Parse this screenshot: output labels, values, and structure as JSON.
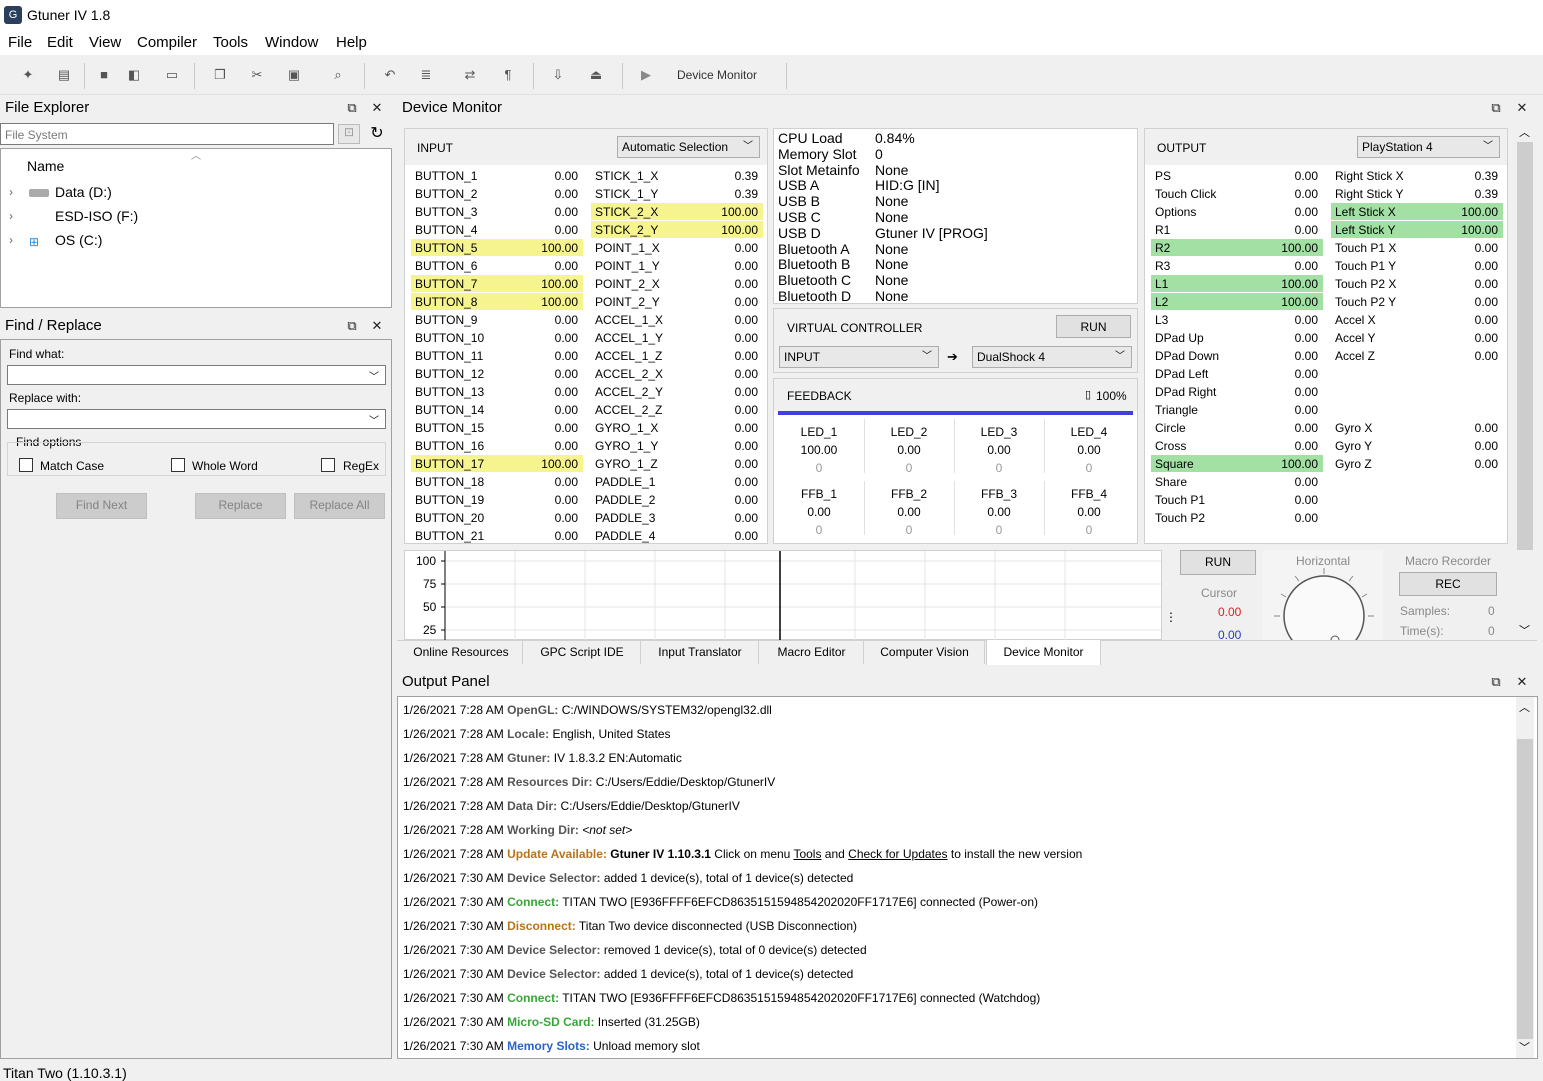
{
  "window": {
    "title": "Gtuner IV 1.8"
  },
  "menu": [
    "File",
    "Edit",
    "View",
    "Compiler",
    "Tools",
    "Window",
    "Help"
  ],
  "toolbar": {
    "device_monitor_label": "Device Monitor"
  },
  "file_explorer": {
    "title": "File Explorer",
    "filter_placeholder": "File System",
    "column_header": "Name",
    "items": [
      "Data (D:)",
      "ESD-ISO (F:)",
      "OS (C:)"
    ]
  },
  "find_replace": {
    "title": "Find / Replace",
    "find_label": "Find what:",
    "replace_label": "Replace with:",
    "options_label": "Find options",
    "match_case": "Match Case",
    "whole_word": "Whole Word",
    "regex": "RegEx",
    "find_next": "Find Next",
    "replace": "Replace",
    "replace_all": "Replace All"
  },
  "device_monitor": {
    "title": "Device Monitor",
    "input": {
      "header": "INPUT",
      "selection": "Automatic Selection",
      "col1": [
        {
          "name": "BUTTON_1",
          "value": "0.00",
          "hl": false
        },
        {
          "name": "BUTTON_2",
          "value": "0.00",
          "hl": false
        },
        {
          "name": "BUTTON_3",
          "value": "0.00",
          "hl": false
        },
        {
          "name": "BUTTON_4",
          "value": "0.00",
          "hl": false
        },
        {
          "name": "BUTTON_5",
          "value": "100.00",
          "hl": true
        },
        {
          "name": "BUTTON_6",
          "value": "0.00",
          "hl": false
        },
        {
          "name": "BUTTON_7",
          "value": "100.00",
          "hl": true
        },
        {
          "name": "BUTTON_8",
          "value": "100.00",
          "hl": true
        },
        {
          "name": "BUTTON_9",
          "value": "0.00",
          "hl": false
        },
        {
          "name": "BUTTON_10",
          "value": "0.00",
          "hl": false
        },
        {
          "name": "BUTTON_11",
          "value": "0.00",
          "hl": false
        },
        {
          "name": "BUTTON_12",
          "value": "0.00",
          "hl": false
        },
        {
          "name": "BUTTON_13",
          "value": "0.00",
          "hl": false
        },
        {
          "name": "BUTTON_14",
          "value": "0.00",
          "hl": false
        },
        {
          "name": "BUTTON_15",
          "value": "0.00",
          "hl": false
        },
        {
          "name": "BUTTON_16",
          "value": "0.00",
          "hl": false
        },
        {
          "name": "BUTTON_17",
          "value": "100.00",
          "hl": true
        },
        {
          "name": "BUTTON_18",
          "value": "0.00",
          "hl": false
        },
        {
          "name": "BUTTON_19",
          "value": "0.00",
          "hl": false
        },
        {
          "name": "BUTTON_20",
          "value": "0.00",
          "hl": false
        },
        {
          "name": "BUTTON_21",
          "value": "0.00",
          "hl": false
        }
      ],
      "col2": [
        {
          "name": "STICK_1_X",
          "value": "0.39",
          "hl": false
        },
        {
          "name": "STICK_1_Y",
          "value": "0.39",
          "hl": false
        },
        {
          "name": "STICK_2_X",
          "value": "100.00",
          "hl": true
        },
        {
          "name": "STICK_2_Y",
          "value": "100.00",
          "hl": true
        },
        {
          "name": "POINT_1_X",
          "value": "0.00",
          "hl": false
        },
        {
          "name": "POINT_1_Y",
          "value": "0.00",
          "hl": false
        },
        {
          "name": "POINT_2_X",
          "value": "0.00",
          "hl": false
        },
        {
          "name": "POINT_2_Y",
          "value": "0.00",
          "hl": false
        },
        {
          "name": "ACCEL_1_X",
          "value": "0.00",
          "hl": false
        },
        {
          "name": "ACCEL_1_Y",
          "value": "0.00",
          "hl": false
        },
        {
          "name": "ACCEL_1_Z",
          "value": "0.00",
          "hl": false
        },
        {
          "name": "ACCEL_2_X",
          "value": "0.00",
          "hl": false
        },
        {
          "name": "ACCEL_2_Y",
          "value": "0.00",
          "hl": false
        },
        {
          "name": "ACCEL_2_Z",
          "value": "0.00",
          "hl": false
        },
        {
          "name": "GYRO_1_X",
          "value": "0.00",
          "hl": false
        },
        {
          "name": "GYRO_1_Y",
          "value": "0.00",
          "hl": false
        },
        {
          "name": "GYRO_1_Z",
          "value": "0.00",
          "hl": false
        },
        {
          "name": "PADDLE_1",
          "value": "0.00",
          "hl": false
        },
        {
          "name": "PADDLE_2",
          "value": "0.00",
          "hl": false
        },
        {
          "name": "PADDLE_3",
          "value": "0.00",
          "hl": false
        },
        {
          "name": "PADDLE_4",
          "value": "0.00",
          "hl": false
        }
      ]
    },
    "info": [
      {
        "label": "CPU Load",
        "value": "0.84%"
      },
      {
        "label": "Memory Slot",
        "value": "0"
      },
      {
        "label": "Slot Metainfo",
        "value": "None"
      },
      {
        "label": "USB A",
        "value": "HID:G [IN]"
      },
      {
        "label": "USB B",
        "value": "None"
      },
      {
        "label": "USB C",
        "value": "None"
      },
      {
        "label": "USB D",
        "value": "Gtuner IV [PROG]"
      },
      {
        "label": "Bluetooth A",
        "value": "None"
      },
      {
        "label": "Bluetooth B",
        "value": "None"
      },
      {
        "label": "Bluetooth C",
        "value": "None"
      },
      {
        "label": "Bluetooth D",
        "value": "None"
      }
    ],
    "virtual_controller": {
      "header": "VIRTUAL CONTROLLER",
      "run": "RUN",
      "source": "INPUT",
      "target": "DualShock 4",
      "arrow": "➔"
    },
    "feedback": {
      "header": "FEEDBACK",
      "battery": "100%",
      "leds": [
        {
          "name": "LED_1",
          "value": "100.00",
          "sub": "0"
        },
        {
          "name": "LED_2",
          "value": "0.00",
          "sub": "0"
        },
        {
          "name": "LED_3",
          "value": "0.00",
          "sub": "0"
        },
        {
          "name": "LED_4",
          "value": "0.00",
          "sub": "0"
        }
      ],
      "ffb": [
        {
          "name": "FFB_1",
          "value": "0.00",
          "sub": "0"
        },
        {
          "name": "FFB_2",
          "value": "0.00",
          "sub": "0"
        },
        {
          "name": "FFB_3",
          "value": "0.00",
          "sub": "0"
        },
        {
          "name": "FFB_4",
          "value": "0.00",
          "sub": "0"
        }
      ]
    },
    "output": {
      "header": "OUTPUT",
      "selection": "PlayStation 4",
      "col1": [
        {
          "name": "PS",
          "value": "0.00",
          "hl": false
        },
        {
          "name": "Touch Click",
          "value": "0.00",
          "hl": false
        },
        {
          "name": "Options",
          "value": "0.00",
          "hl": false
        },
        {
          "name": "R1",
          "value": "0.00",
          "hl": false
        },
        {
          "name": "R2",
          "value": "100.00",
          "hl": true
        },
        {
          "name": "R3",
          "value": "0.00",
          "hl": false
        },
        {
          "name": "L1",
          "value": "100.00",
          "hl": true
        },
        {
          "name": "L2",
          "value": "100.00",
          "hl": true
        },
        {
          "name": "L3",
          "value": "0.00",
          "hl": false
        },
        {
          "name": "DPad Up",
          "value": "0.00",
          "hl": false
        },
        {
          "name": "DPad Down",
          "value": "0.00",
          "hl": false
        },
        {
          "name": "DPad Left",
          "value": "0.00",
          "hl": false
        },
        {
          "name": "DPad Right",
          "value": "0.00",
          "hl": false
        },
        {
          "name": "Triangle",
          "value": "0.00",
          "hl": false
        },
        {
          "name": "Circle",
          "value": "0.00",
          "hl": false
        },
        {
          "name": "Cross",
          "value": "0.00",
          "hl": false
        },
        {
          "name": "Square",
          "value": "100.00",
          "hl": true
        },
        {
          "name": "Share",
          "value": "0.00",
          "hl": false
        },
        {
          "name": "Touch P1",
          "value": "0.00",
          "hl": false
        },
        {
          "name": "Touch P2",
          "value": "0.00",
          "hl": false
        }
      ],
      "col2": [
        {
          "name": "Right Stick X",
          "value": "0.39",
          "hl": false
        },
        {
          "name": "Right Stick Y",
          "value": "0.39",
          "hl": false
        },
        {
          "name": "Left Stick X",
          "value": "100.00",
          "hl": true
        },
        {
          "name": "Left Stick Y",
          "value": "100.00",
          "hl": true
        },
        {
          "name": "Touch P1 X",
          "value": "0.00",
          "hl": false
        },
        {
          "name": "Touch P1 Y",
          "value": "0.00",
          "hl": false
        },
        {
          "name": "Touch P2 X",
          "value": "0.00",
          "hl": false
        },
        {
          "name": "Touch P2 Y",
          "value": "0.00",
          "hl": false
        },
        {
          "name": "Accel X",
          "value": "0.00",
          "hl": false
        },
        {
          "name": "Accel Y",
          "value": "0.00",
          "hl": false
        },
        {
          "name": "Accel Z",
          "value": "0.00",
          "hl": false
        },
        {
          "name": "",
          "value": "",
          "hl": false
        },
        {
          "name": "",
          "value": "",
          "hl": false
        },
        {
          "name": "",
          "value": "",
          "hl": false
        },
        {
          "name": "Gyro X",
          "value": "0.00",
          "hl": false
        },
        {
          "name": "Gyro Y",
          "value": "0.00",
          "hl": false
        },
        {
          "name": "Gyro Z",
          "value": "0.00",
          "hl": false
        }
      ]
    },
    "graph": {
      "ticks": [
        "100",
        "75",
        "50",
        "25"
      ]
    },
    "macro_controls": {
      "run": "RUN",
      "cursor_label": "Cursor",
      "cursor_red": "0.00",
      "cursor_blue": "0.00",
      "horizontal_label": "Horizontal",
      "macro_recorder_label": "Macro Recorder",
      "rec": "REC",
      "samples_label": "Samples:",
      "samples_value": "0",
      "time_label": "Time(s):",
      "time_value": "0"
    },
    "tabs": [
      "Online Resources",
      "GPC Script IDE",
      "Input Translator",
      "Macro Editor",
      "Computer Vision",
      "Device Monitor"
    ],
    "active_tab": "Device Monitor"
  },
  "output_panel": {
    "title": "Output Panel",
    "lines": [
      {
        "ts": "1/26/2021 7:28 AM",
        "label": "OpenGL:",
        "style": "b",
        "text": "C:/WINDOWS/SYSTEM32/opengl32.dll"
      },
      {
        "ts": "1/26/2021 7:28 AM",
        "label": "Locale:",
        "style": "b",
        "text": "English, United States"
      },
      {
        "ts": "1/26/2021 7:28 AM",
        "label": "Gtuner:",
        "style": "b",
        "text": "IV 1.8.3.2 EN:Automatic"
      },
      {
        "ts": "1/26/2021 7:28 AM",
        "label": "Resources Dir:",
        "style": "b",
        "text": "C:/Users/Eddie/Desktop/GtunerIV"
      },
      {
        "ts": "1/26/2021 7:28 AM",
        "label": "Data Dir:",
        "style": "b",
        "text": "C:/Users/Eddie/Desktop/GtunerIV"
      },
      {
        "ts": "1/26/2021 7:28 AM",
        "label": "Working Dir:",
        "style": "b",
        "text": "<not set>",
        "italic": true
      },
      {
        "ts": "1/26/2021 7:28 AM",
        "label": "Update Available:",
        "style": "o",
        "text": "",
        "update": true
      },
      {
        "ts": "1/26/2021 7:30 AM",
        "label": "Device Selector:",
        "style": "b",
        "text": "added 1 device(s), total of 1 device(s) detected"
      },
      {
        "ts": "1/26/2021 7:30 AM",
        "label": "Connect:",
        "style": "g",
        "text": "TITAN TWO [E936FFFF6EFCD8635151594854202020FF1717E6] connected (Power-on)"
      },
      {
        "ts": "1/26/2021 7:30 AM",
        "label": "Disconnect:",
        "style": "o",
        "text": "Titan Two device disconnected (USB Disconnection)"
      },
      {
        "ts": "1/26/2021 7:30 AM",
        "label": "Device Selector:",
        "style": "b",
        "text": "removed 1 device(s), total of 0 device(s) detected"
      },
      {
        "ts": "1/26/2021 7:30 AM",
        "label": "Device Selector:",
        "style": "b",
        "text": "added 1 device(s), total of 1 device(s) detected"
      },
      {
        "ts": "1/26/2021 7:30 AM",
        "label": "Connect:",
        "style": "g",
        "text": "TITAN TWO [E936FFFF6EFCD8635151594854202020FF1717E6] connected (Watchdog)"
      },
      {
        "ts": "1/26/2021 7:30 AM",
        "label": "Micro-SD Card:",
        "style": "g",
        "text": "Inserted (31.25GB)"
      },
      {
        "ts": "1/26/2021 7:30 AM",
        "label": "Memory Slots:",
        "style": "blue",
        "text": "Unload memory slot"
      }
    ],
    "update": {
      "version": "Gtuner IV 1.10.3.1",
      "t1": " Click on menu ",
      "link1": "Tools",
      "t2": " and ",
      "link2": "Check for Updates",
      "t3": " to install the new version"
    }
  },
  "status_bar": {
    "text": "Titan Two (1.10.3.1)"
  },
  "colors": {
    "yellow_highlight": "#f6f48e",
    "green_highlight": "#a2e0a4",
    "feedback_bar": "#4040e0"
  }
}
